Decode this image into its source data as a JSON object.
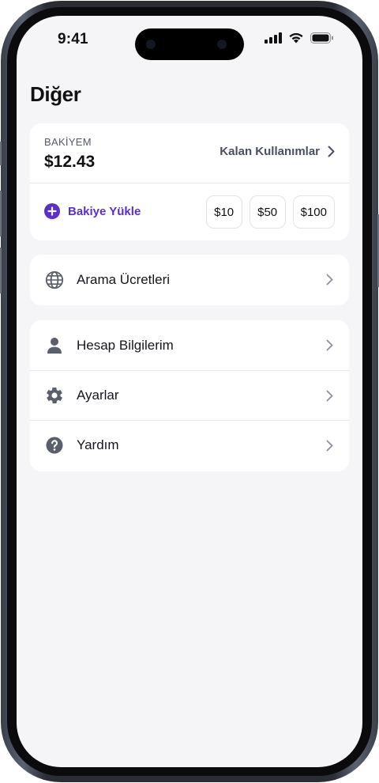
{
  "status_bar": {
    "time": "9:41"
  },
  "page": {
    "title": "Diğer"
  },
  "balance": {
    "caption": "BAKİYEM",
    "amount": "$12.43",
    "remaining_label": "Kalan Kullanımlar",
    "topup_label": "Bakiye Yükle",
    "topup_amounts": [
      "$10",
      "$50",
      "$100"
    ]
  },
  "menu": {
    "calls": {
      "label": "Arama Ücretleri",
      "icon": "globe-icon"
    },
    "account": {
      "label": "Hesap Bilgilerim",
      "icon": "user-icon"
    },
    "settings": {
      "label": "Ayarlar",
      "icon": "gear-icon"
    },
    "help": {
      "label": "Yardım",
      "icon": "help-icon"
    }
  },
  "colors": {
    "accent": "#5b2fc9",
    "background": "#f5f5f7",
    "card": "#ffffff",
    "icon": "#5a5f6b"
  }
}
